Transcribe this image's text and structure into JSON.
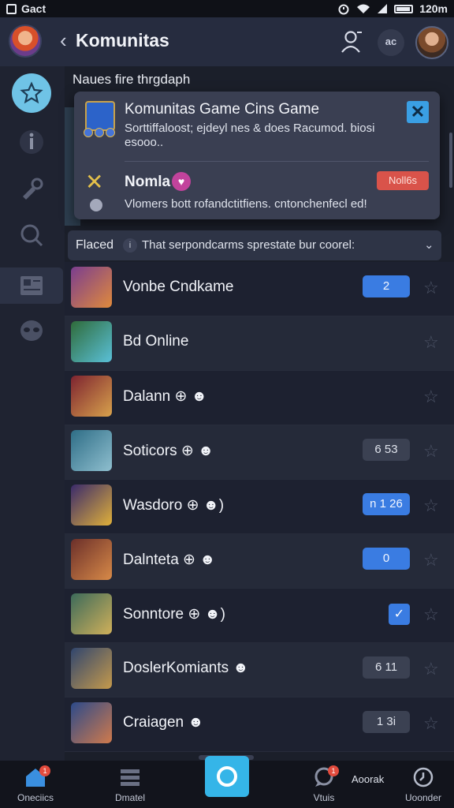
{
  "status_bar": {
    "left_text": "Gact",
    "time": "120m"
  },
  "header": {
    "title": "Komunitas",
    "more_label": "ac"
  },
  "section": {
    "title": "Naues fire thrgdaph"
  },
  "popup": {
    "title": "Komunitas Game Cins Game",
    "text": "Sorttiffaloost; ejdeyl nes & does Racumod. biosi esooo..",
    "name": "Nomla",
    "badge": "Noll6s",
    "footer": "Vlomers bott rofandctitfiens. cntonchenfecl ed!"
  },
  "filter": {
    "label": "Flaced",
    "info_icon": "i",
    "text": "That serpondcarms sprestate bur coorel:"
  },
  "games": [
    {
      "name": "Vonbe Cndkame",
      "pill": "2",
      "pill_style": "blue",
      "colors": [
        "#7a3d8f",
        "#e08a3c"
      ]
    },
    {
      "name": "Bd Online",
      "pill": "",
      "pill_style": "none",
      "colors": [
        "#2f6b3a",
        "#5ac0d8"
      ]
    },
    {
      "name": "Dalann ⊕ ☻",
      "pill": "",
      "pill_style": "none",
      "colors": [
        "#7d2330",
        "#d8a24c"
      ]
    },
    {
      "name": "Soticors ⊕ ☻",
      "pill": "6 53",
      "pill_style": "gray",
      "colors": [
        "#2e6d86",
        "#8fbfcf"
      ]
    },
    {
      "name": "Wasdoro ⊕ ☻)",
      "pill": "n 1 26",
      "pill_style": "blue",
      "colors": [
        "#3a2a6b",
        "#e0b03a"
      ]
    },
    {
      "name": "Dalnteta ⊕ ☻",
      "pill": "0",
      "pill_style": "blue",
      "colors": [
        "#6b2f2a",
        "#d88a48"
      ]
    },
    {
      "name": "Sonntore ⊕ ☻)",
      "pill": "",
      "pill_style": "check",
      "colors": [
        "#3c6a5a",
        "#d0b05a"
      ]
    },
    {
      "name": "DoslerKomiants ☻",
      "pill": "6 11",
      "pill_style": "gray",
      "colors": [
        "#30456e",
        "#c59a4c"
      ]
    },
    {
      "name": "Craiagen ☻",
      "pill": "1 3i",
      "pill_style": "gray",
      "colors": [
        "#2c4a8a",
        "#d07a4c"
      ]
    }
  ],
  "bottom_nav": {
    "items": [
      {
        "label": "Oneciics",
        "icon": "home-icon",
        "badge": "1"
      },
      {
        "label": "Dmatel",
        "icon": "deck-icon",
        "badge": ""
      },
      {
        "label": "",
        "icon": "center-circle-icon",
        "badge": ""
      },
      {
        "label": "Vtuis",
        "icon": "chat-icon",
        "badge": "1"
      },
      {
        "label": "Uoonder",
        "icon": "profile-icon",
        "badge": ""
      }
    ],
    "extra_label": "Aoorak"
  },
  "colors": {
    "accent": "#3a7ce2",
    "header_bg": "#262c3f",
    "sidebar_active": "#6fc3e6",
    "danger": "#d9534a"
  }
}
